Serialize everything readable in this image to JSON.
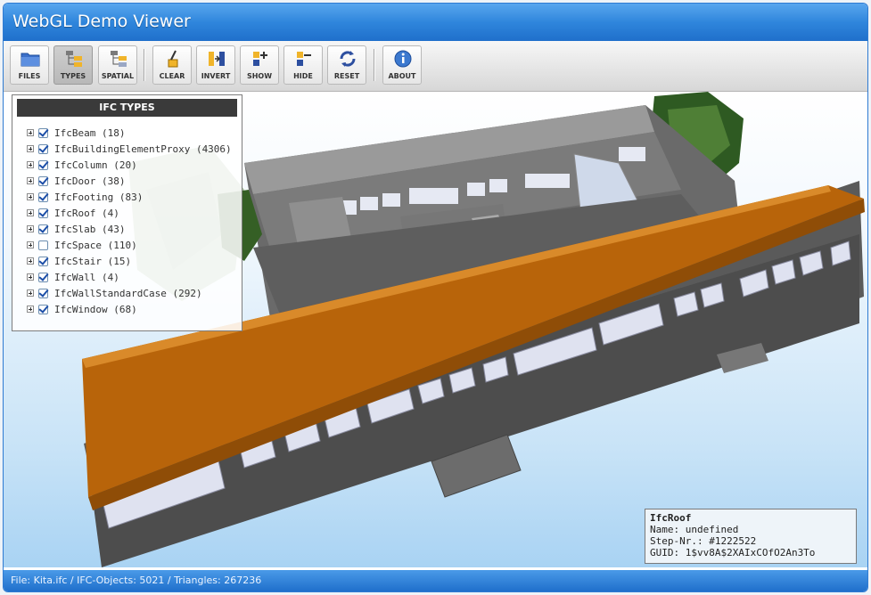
{
  "app": {
    "title": "WebGL Demo Viewer"
  },
  "toolbar": {
    "buttons": [
      {
        "label": "FILES",
        "icon": "folder-icon"
      },
      {
        "label": "TYPES",
        "icon": "types-tree-icon",
        "active": true
      },
      {
        "label": "SPATIAL",
        "icon": "spatial-tree-icon"
      },
      {
        "label": "CLEAR",
        "icon": "clear-icon"
      },
      {
        "label": "INVERT",
        "icon": "invert-icon"
      },
      {
        "label": "SHOW",
        "icon": "show-icon"
      },
      {
        "label": "HIDE",
        "icon": "hide-icon"
      },
      {
        "label": "RESET",
        "icon": "reset-icon"
      },
      {
        "label": "ABOUT",
        "icon": "info-icon"
      }
    ]
  },
  "types_panel": {
    "title": "IFC TYPES",
    "items": [
      {
        "label": "IfcBeam  (18)",
        "checked": true
      },
      {
        "label": "IfcBuildingElementProxy  (4306)",
        "checked": true
      },
      {
        "label": "IfcColumn  (20)",
        "checked": true
      },
      {
        "label": "IfcDoor  (38)",
        "checked": true
      },
      {
        "label": "IfcFooting  (83)",
        "checked": true
      },
      {
        "label": "IfcRoof  (4)",
        "checked": true
      },
      {
        "label": "IfcSlab  (43)",
        "checked": true
      },
      {
        "label": "IfcSpace  (110)",
        "checked": false
      },
      {
        "label": "IfcStair  (15)",
        "checked": true
      },
      {
        "label": "IfcWall  (4)",
        "checked": true
      },
      {
        "label": "IfcWallStandardCase  (292)",
        "checked": true
      },
      {
        "label": "IfcWindow  (68)",
        "checked": true
      }
    ]
  },
  "selection_info": {
    "type": "IfcRoof",
    "name": "Name: undefined",
    "step": "Step-Nr.: #1222522",
    "guid": "GUID: 1$vv8A$2XAIxCOfO2An3To"
  },
  "status": {
    "text": "File: Kita.ifc / IFC-Objects: 5021 / Triangles: 267236"
  },
  "colors": {
    "title_bar": "#2f86dc",
    "roof": "#c06a0a",
    "wall": "#5a5a5a",
    "status_bar": "#1f6fcb"
  }
}
